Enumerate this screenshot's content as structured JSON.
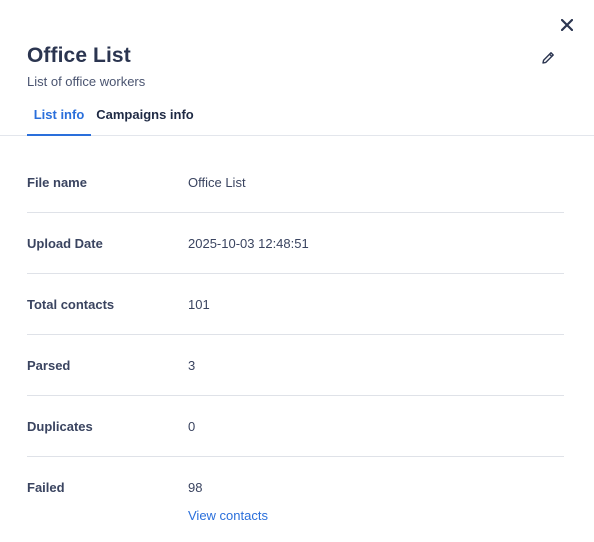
{
  "header": {
    "title": "Office List",
    "subtitle": "List of office workers",
    "close_icon": "close-icon",
    "edit_icon": "pencil-icon"
  },
  "tabs": [
    {
      "label": "List info",
      "active": true
    },
    {
      "label": "Campaigns info",
      "active": false
    }
  ],
  "details": [
    {
      "label": "File name",
      "value": "Office List"
    },
    {
      "label": "Upload Date",
      "value": "2025-10-03 12:48:51"
    },
    {
      "label": "Total contacts",
      "value": "101"
    },
    {
      "label": "Parsed",
      "value": "3"
    },
    {
      "label": "Duplicates",
      "value": "0"
    },
    {
      "label": "Failed",
      "value": "98"
    }
  ],
  "view_contacts_label": "View contacts",
  "colors": {
    "accent": "#2a6fdb",
    "text": "#3a4460",
    "divider": "#dfe2e8"
  }
}
